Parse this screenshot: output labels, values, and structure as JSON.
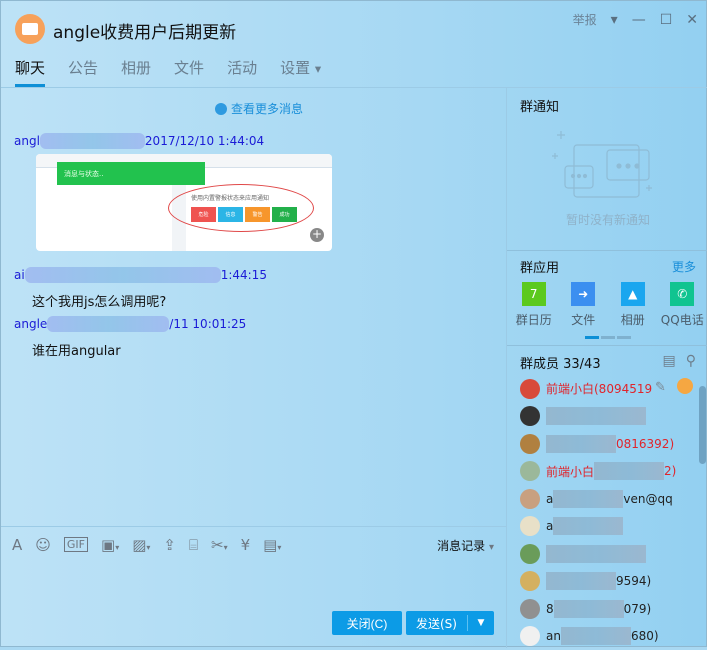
{
  "window": {
    "title": "angle收费用户后期更新",
    "report": "举报"
  },
  "tabs": [
    "聊天",
    "公告",
    "相册",
    "文件",
    "活动",
    "设置"
  ],
  "chat": {
    "more_messages": "查看更多消息",
    "messages": [
      {
        "sender_prefix": "angl",
        "time_suffix": "2017/12/10 1:44:04",
        "type": "image",
        "image": {
          "toast": "消息与状态..",
          "caption": "使用内置警报状态来应用通知",
          "buttons": [
            "危险",
            "信息",
            "警告",
            "成功"
          ]
        }
      },
      {
        "sender_prefix": "ai",
        "time_suffix": "1:44:15",
        "text": "这个我用js怎么调用呢?"
      },
      {
        "sender_prefix": "angle",
        "time_suffix": "/11 10:01:25",
        "text": "谁在用angular"
      }
    ]
  },
  "toolbar": {
    "history": "消息记录",
    "gif": "GIF"
  },
  "buttons": {
    "close": "关闭(C)",
    "send": "发送(S)"
  },
  "notice": {
    "title": "群通知",
    "empty": "暂时没有新通知"
  },
  "apps": {
    "title": "群应用",
    "more": "更多",
    "items": [
      {
        "label": "群日历",
        "color": "#5cc91e",
        "glyph": "7"
      },
      {
        "label": "文件",
        "color": "#3b8ff0",
        "glyph": "➜"
      },
      {
        "label": "相册",
        "color": "#1aa6ef",
        "glyph": "▲"
      },
      {
        "label": "QQ电话",
        "color": "#10c490",
        "glyph": "✆"
      }
    ]
  },
  "members": {
    "title": "群成员 33/43",
    "list": [
      {
        "prefix": "前端小白(8094519",
        "suffix": "",
        "color": "red",
        "av": "#d84a3a"
      },
      {
        "prefix": "",
        "suffix": "",
        "color": "blk",
        "av": "#333"
      },
      {
        "prefix": "",
        "suffix": "0816392)",
        "color": "red",
        "av": "#b08040"
      },
      {
        "prefix": "前端小白",
        "suffix": "2)",
        "color": "red",
        "av": "#9bb89a"
      },
      {
        "prefix": "a",
        "suffix": "ven@qq",
        "color": "blk",
        "av": "#c8a080"
      },
      {
        "prefix": "a",
        "suffix": "",
        "color": "blk",
        "av": "#e8e0c8"
      },
      {
        "prefix": "",
        "suffix": "",
        "color": "blk",
        "av": "#6a9c5a"
      },
      {
        "prefix": "",
        "suffix": "9594)",
        "color": "blk",
        "av": "#d4b060"
      },
      {
        "prefix": "8",
        "suffix": "079)",
        "color": "blk",
        "av": "#909090"
      },
      {
        "prefix": "an",
        "suffix": "680)",
        "color": "blk",
        "av": "#f0f0f0"
      }
    ]
  }
}
